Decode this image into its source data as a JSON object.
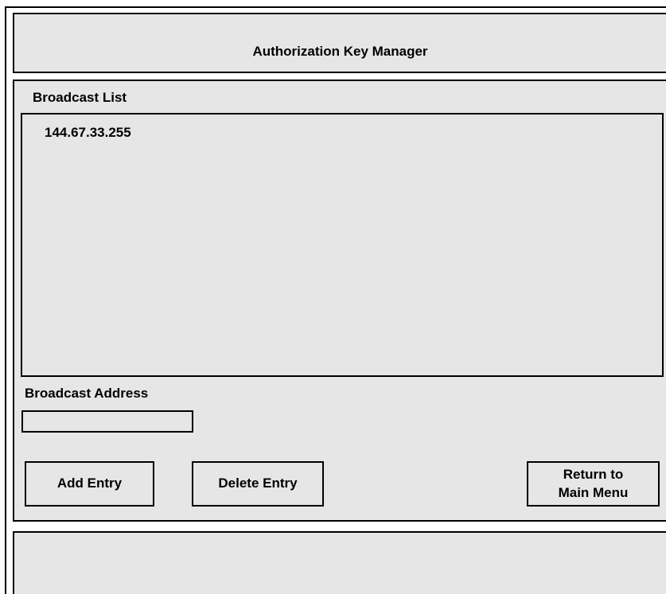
{
  "window": {
    "title": "Authorization Key Manager"
  },
  "broadcast_list": {
    "label": "Broadcast List",
    "items": [
      "144.67.33.255"
    ]
  },
  "broadcast_address": {
    "label": "Broadcast Address",
    "value": "",
    "placeholder": ""
  },
  "buttons": {
    "add_entry": "Add Entry",
    "delete_entry": "Delete Entry",
    "return_line1": "Return to",
    "return_line2": "Main Menu"
  },
  "status": {
    "message": ""
  },
  "colors": {
    "panel_background": "#e6e6e6",
    "border": "#000000"
  }
}
